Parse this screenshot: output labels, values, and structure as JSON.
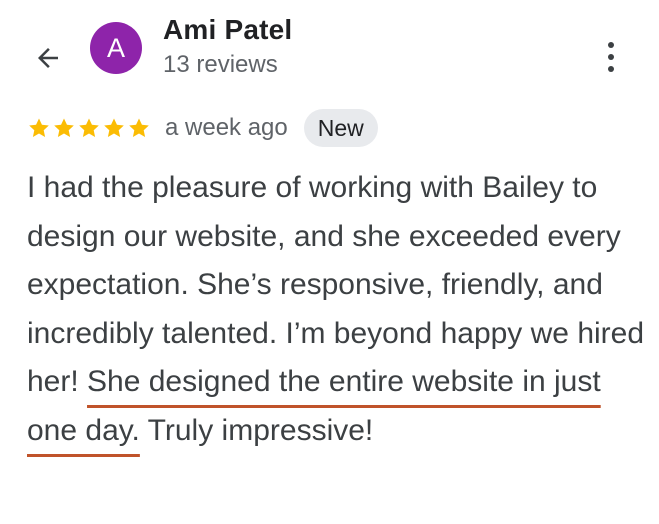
{
  "header": {
    "back_icon": "arrow-back-icon",
    "more_icon": "more-vert-icon"
  },
  "reviewer": {
    "avatar_letter": "A",
    "avatar_color": "#8e24aa",
    "name": "Ami Patel",
    "review_count": "13 reviews"
  },
  "review": {
    "rating": 5,
    "max_rating": 5,
    "star_color": "#fbbc04",
    "time_ago": "a week ago",
    "badge": "New",
    "text_part1": "I had the pleasure of working with Bailey to design our website, and she exceeded every expectation. She’s responsive, friendly, and incredibly talented. I’m beyond happy we hired her! ",
    "text_highlighted": "She designed the entire website in just one day.",
    "text_part2": " Truly impressive!",
    "highlight_color": "#c0532a"
  }
}
